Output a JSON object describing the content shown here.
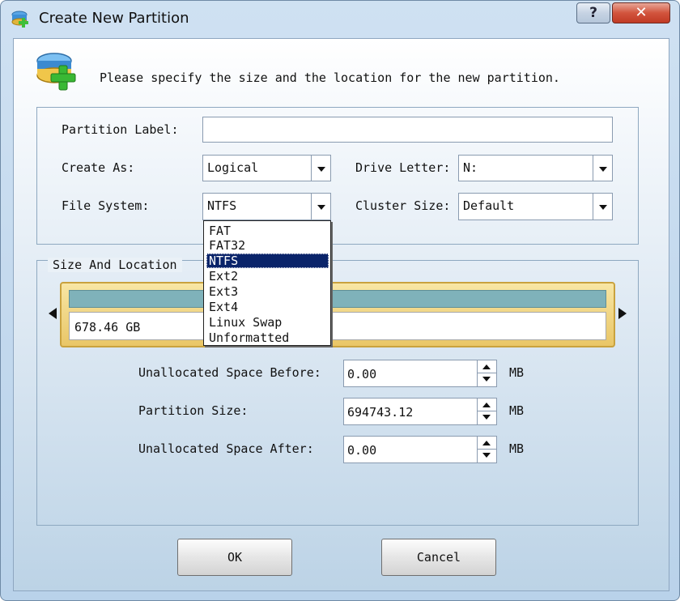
{
  "window": {
    "title": "Create New Partition",
    "help_label": "?",
    "close_label": "✕"
  },
  "header": {
    "instruction": "Please specify the size and the location for the new partition."
  },
  "form": {
    "partition_label": {
      "label": "Partition Label:",
      "value": ""
    },
    "create_as": {
      "label": "Create As:",
      "value": "Logical"
    },
    "drive_letter": {
      "label": "Drive Letter:",
      "value": "N:"
    },
    "file_system": {
      "label": "File System:",
      "value": "NTFS",
      "options": [
        "FAT",
        "FAT32",
        "NTFS",
        "Ext2",
        "Ext3",
        "Ext4",
        "Linux Swap",
        "Unformatted"
      ],
      "highlighted": "NTFS"
    },
    "cluster_size": {
      "label": "Cluster Size:",
      "value": "Default"
    }
  },
  "size_location": {
    "group_title": "Size And Location",
    "disk_size_label": "678.46 GB",
    "unallocated_before": {
      "label": "Unallocated Space Before:",
      "value": "0.00",
      "unit": "MB"
    },
    "partition_size": {
      "label": "Partition Size:",
      "value": "694743.12",
      "unit": "MB"
    },
    "unallocated_after": {
      "label": "Unallocated Space After:",
      "value": "0.00",
      "unit": "MB"
    }
  },
  "buttons": {
    "ok": "OK",
    "cancel": "Cancel"
  },
  "colors": {
    "selection": "#0a246a",
    "disk_fill": "#7fb2ba",
    "disk_frame": "#e9c667",
    "close_button": "#d2543d"
  }
}
